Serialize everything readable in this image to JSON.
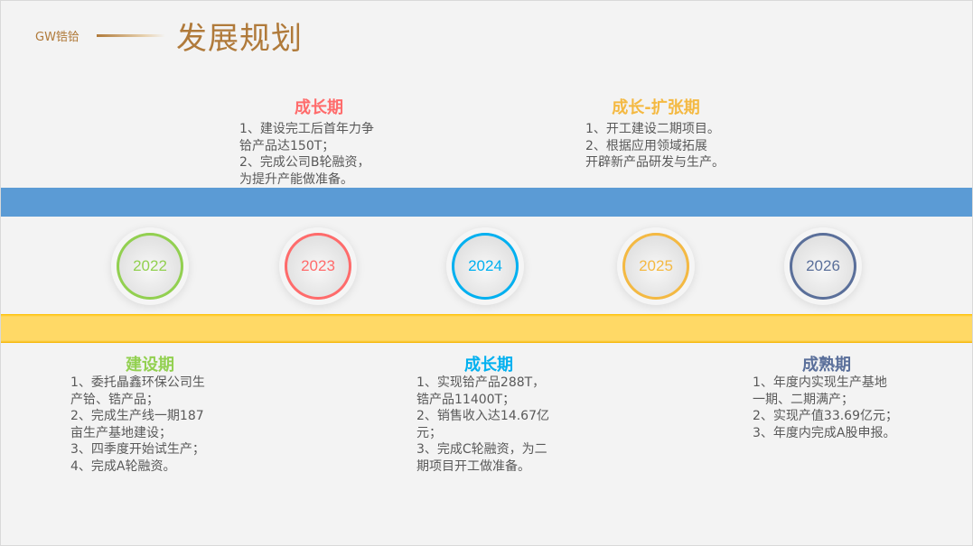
{
  "header": {
    "brand": "GW锆铪",
    "title": "发展规划"
  },
  "timeline": [
    {
      "year": "2022",
      "color": "#92d050",
      "phase": "建设期",
      "position": "bottom",
      "lines": [
        "1、委托晶鑫环保公司生",
        "产铪、锆产品；",
        "2、完成生产线一期187",
        "亩生产基地建设；",
        "3、四季度开始试生产；",
        "4、完成A轮融资。"
      ]
    },
    {
      "year": "2023",
      "color": "#ff6b6b",
      "phase": "成长期",
      "position": "top",
      "lines": [
        "1、建设完工后首年力争",
        "铪产品达150T；",
        "2、完成公司B轮融资，",
        "为提升产能做准备。"
      ]
    },
    {
      "year": "2024",
      "color": "#00b0f0",
      "phase": "成长期",
      "position": "bottom",
      "lines": [
        "1、实现铪产品288T，",
        "锆产品11400T；",
        "2、销售收入达14.67亿",
        "元；",
        "3、完成C轮融资，为二",
        "期项目开工做准备。"
      ]
    },
    {
      "year": "2025",
      "color": "#f4b942",
      "phase": "成长-扩张期",
      "position": "top",
      "lines": [
        "1、开工建设二期项目。",
        "2、根据应用领域拓展",
        "开辟新产品研发与生产。"
      ]
    },
    {
      "year": "2026",
      "color": "#5a6f9a",
      "phase": "成熟期",
      "position": "bottom",
      "lines": [
        "1、年度内实现生产基地",
        "一期、二期满产；",
        "2、实现产值33.69亿元；",
        "3、年度内完成A股申报。"
      ]
    }
  ]
}
